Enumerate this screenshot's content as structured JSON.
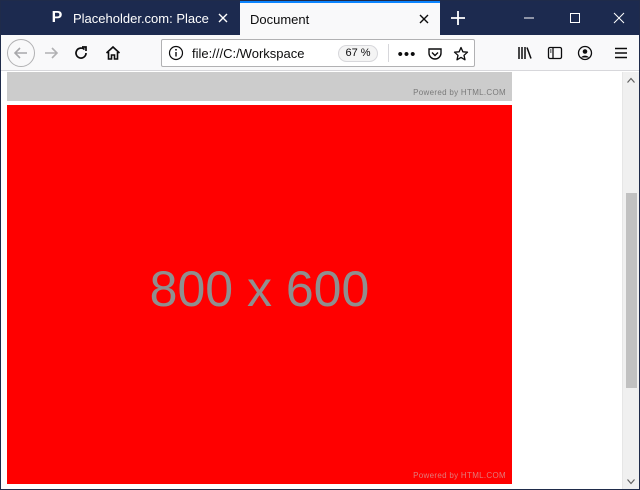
{
  "tabs": [
    {
      "title": "Placeholder.com: Placeholder",
      "favicon": "P",
      "active": false
    },
    {
      "title": "Document",
      "active": true
    }
  ],
  "toolbar": {
    "url": "file:///C:/Workspace",
    "zoom": "67 %",
    "more_label": "•••"
  },
  "page": {
    "placeholder_text": "800 x 600",
    "powered_top": "Powered by HTML.COM",
    "powered_bottom": "Powered by HTML.COM",
    "colors": {
      "top_image": "#cccccc",
      "main_image": "#ff0000",
      "placeholder_text": "#8f8f8f"
    }
  },
  "scrollbar": {
    "position_fraction": 0.55
  },
  "icons": {
    "tab_favicon": "placeholder-favicon",
    "tab_close": "close-icon",
    "new_tab": "plus-icon",
    "minimize": "minimize-icon",
    "maximize": "maximize-icon",
    "window_close": "close-icon",
    "back": "arrow-left-icon",
    "forward": "arrow-right-icon",
    "reload": "reload-icon",
    "home": "home-icon",
    "info": "info-icon",
    "pocket": "pocket-icon",
    "bookmark": "star-icon",
    "library": "library-icon",
    "sidebar": "sidebar-icon",
    "account": "account-icon",
    "menu": "hamburger-menu-icon"
  }
}
